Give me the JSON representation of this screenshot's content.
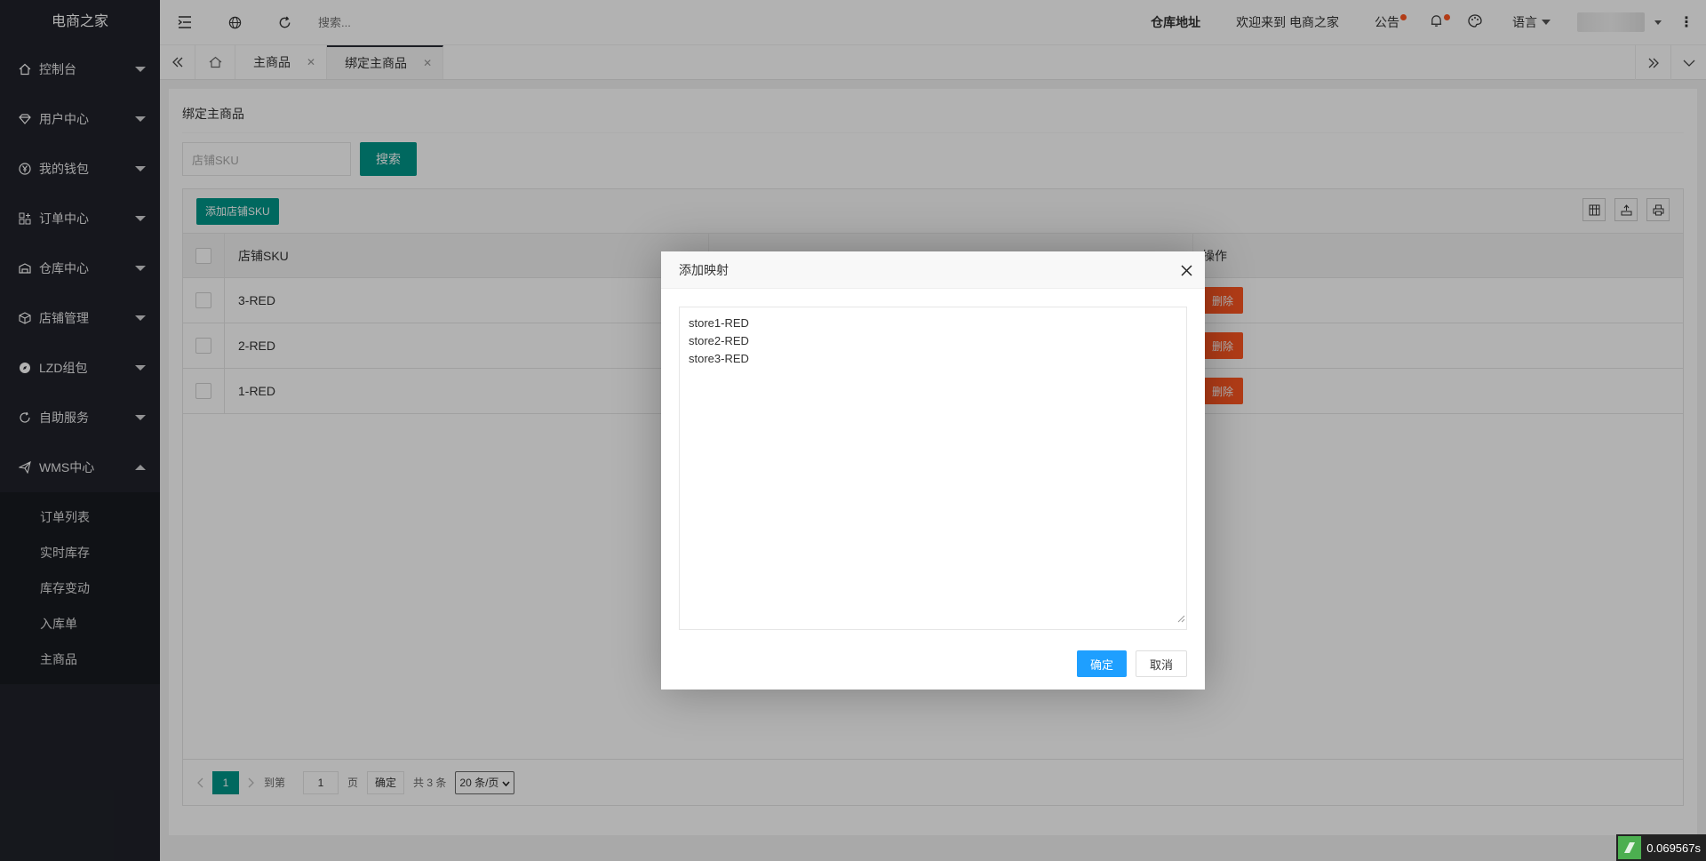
{
  "app": {
    "logo": "电商之家"
  },
  "sidebar": {
    "items": [
      {
        "label": "控制台",
        "icon": "home-icon"
      },
      {
        "label": "用户中心",
        "icon": "diamond-icon"
      },
      {
        "label": "我的钱包",
        "icon": "yen-icon"
      },
      {
        "label": "订单中心",
        "icon": "apps-icon"
      },
      {
        "label": "仓库中心",
        "icon": "warehouse-icon"
      },
      {
        "label": "店铺管理",
        "icon": "cube-icon"
      },
      {
        "label": "LZD组包",
        "icon": "compass-icon"
      },
      {
        "label": "自助服务",
        "icon": "refresh-icon"
      },
      {
        "label": "WMS中心",
        "icon": "send-icon"
      }
    ],
    "wms_sub": [
      "订单列表",
      "实时库存",
      "库存变动",
      "入库单",
      "主商品"
    ]
  },
  "header": {
    "search_placeholder": "搜索...",
    "warehouse_address": "仓库地址",
    "welcome": "欢迎来到 电商之家",
    "notice": "公告",
    "language": "语言"
  },
  "tabs": [
    {
      "label": "主商品"
    },
    {
      "label": "绑定主商品"
    }
  ],
  "page": {
    "title": "绑定主商品",
    "search_placeholder": "店铺SKU",
    "search_button": "搜索",
    "add_button": "添加店铺SKU",
    "columns": [
      "店铺SKU",
      "操作"
    ],
    "rows": [
      {
        "sku": "3-RED",
        "action": "删除"
      },
      {
        "sku": "2-RED",
        "action": "删除"
      },
      {
        "sku": "1-RED",
        "action": "删除"
      }
    ],
    "pager": {
      "current": "1",
      "goto_label": "到第",
      "goto_value": "1",
      "page_unit": "页",
      "confirm": "确定",
      "total": "共 3 条",
      "per_page": "20 条/页"
    }
  },
  "modal": {
    "title": "添加映射",
    "lines": [
      "store1-RED",
      "store2-RED",
      "store3-RED"
    ],
    "ok": "确定",
    "cancel": "取消"
  },
  "perf": {
    "time": "0.069567s"
  },
  "colors": {
    "sidebar": "#20222a",
    "teal": "#009688",
    "danger": "#ff5722",
    "primary": "#1e9fff"
  }
}
